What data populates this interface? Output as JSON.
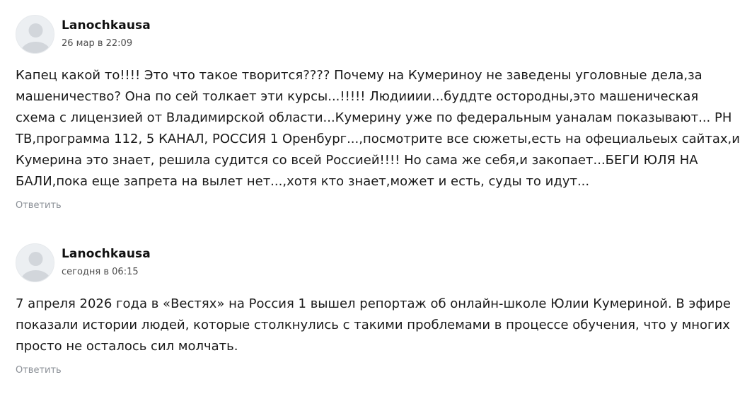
{
  "comments": [
    {
      "author": "Lanochkausa",
      "date": "26 мар в 22:09",
      "text": "Капец какой то!!!! Это что такое творится???? Почему на Кумериноу не заведены уголовные дела,за машеничество? Она по сей толкает эти курсы...!!!!! Людииии...буддте остородны,это машеническая схема с лицензией от Владимирской области...Кумерину уже по федеральным уаналам показывают... РН ТВ,программа 112, 5 КАНАЛ, РОССИЯ 1 Оренбург...,посмотрите все сюжеты,есть на офециальеых сайтах,и Кумерина это знает, решила судится со всей Россией!!!! Но сама же себя,и закопает...БЕГИ ЮЛЯ НА БАЛИ,пока еще запрета на вылет нет...,хотя кто знает,может и есть, суды то идут...",
      "reply_label": "Ответить"
    },
    {
      "author": "Lanochkausa",
      "date": "сегодня в 06:15",
      "text": "7 апреля 2026 года в «Вестях» на Россия 1 вышел репортаж об онлайн-школе Юлии Кумериной. В эфире показали истории людей, которые столкнулись с такими проблемами в процессе обучения, что у многих просто не осталось сил молчать.",
      "reply_label": "Ответить"
    }
  ],
  "icons": {
    "avatar": "user-placeholder-icon"
  },
  "colors": {
    "text": "#1a1a1a",
    "meta": "#4d4d4d",
    "reply": "#8a8f96",
    "avatar_bg": "#eceff2",
    "avatar_fg": "#d2d6db"
  }
}
